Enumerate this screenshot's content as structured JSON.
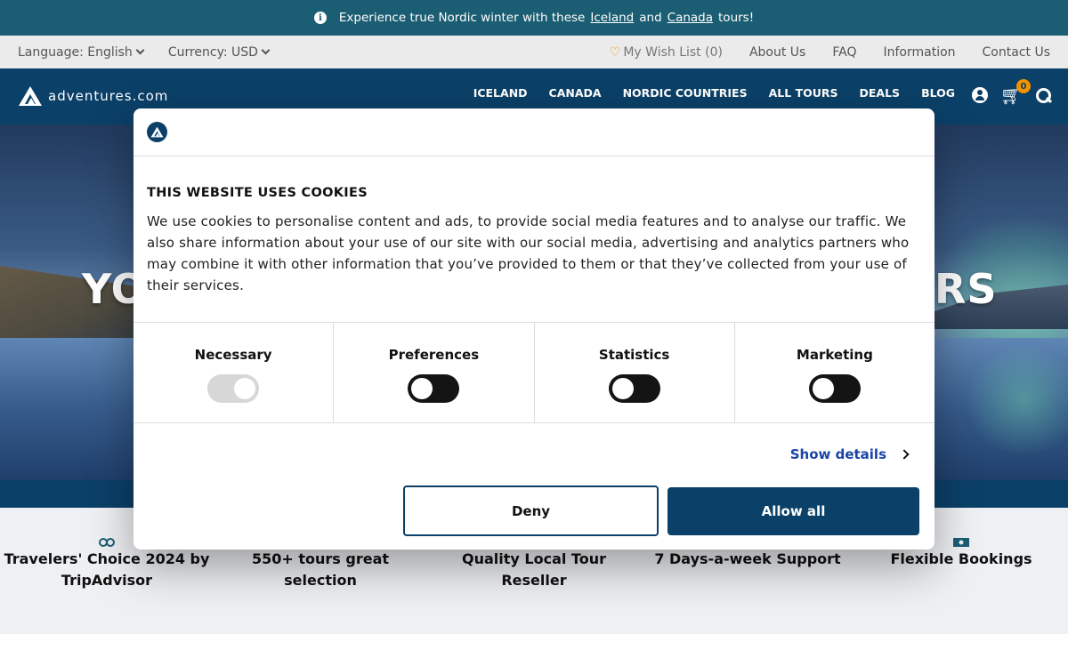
{
  "announcement": {
    "text_before": "Experience true Nordic winter with these",
    "link1": "Iceland",
    "text_between": "and",
    "link2": "Canada",
    "text_after": "tours!"
  },
  "utility": {
    "language": "Language: English",
    "currency": "Currency: USD",
    "wishlist": "My Wish List (0)",
    "links": [
      "About Us",
      "FAQ",
      "Information",
      "Contact Us"
    ]
  },
  "nav": {
    "brand": "adventures.com",
    "items": [
      "ICELAND",
      "CANADA",
      "NORDIC COUNTRIES",
      "ALL TOURS",
      "DEALS",
      "BLOG"
    ],
    "cart_count": "0"
  },
  "hero": {
    "text_left": "YO",
    "text_right": "RS"
  },
  "features": [
    "Travelers' Choice 2024 by TripAdvisor",
    "550+ tours great selection",
    "Quality Local Tour Reseller",
    "7 Days-a-week Support",
    "Flexible Bookings"
  ],
  "cookie": {
    "title": "THIS WEBSITE USES COOKIES",
    "body": "We use cookies to personalise content and ads, to provide social media features and to analyse our traffic. We also share information about your use of our site with our social media, advertising and analytics partners who may combine it with other information that you’ve provided to them or that they’ve collected from your use of their services.",
    "categories": [
      {
        "label": "Necessary",
        "state": "on-locked"
      },
      {
        "label": "Preferences",
        "state": "off"
      },
      {
        "label": "Statistics",
        "state": "off"
      },
      {
        "label": "Marketing",
        "state": "off"
      }
    ],
    "show_details": "Show details",
    "deny": "Deny",
    "allow_all": "Allow all"
  },
  "colors": {
    "brand_navy": "#0b4068",
    "announce_teal": "#1b5d72",
    "accent_orange": "#f39200",
    "link_blue": "#1a44a6"
  }
}
